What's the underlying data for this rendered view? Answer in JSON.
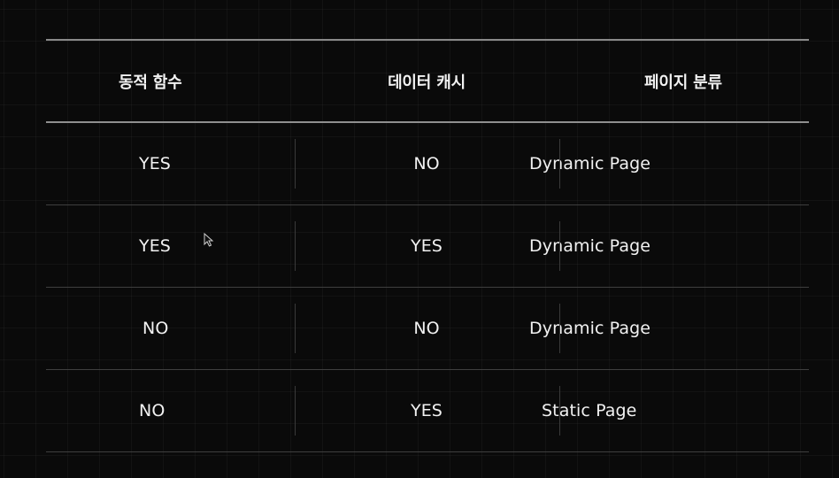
{
  "table": {
    "headers": [
      "동적 함수",
      "데이터 캐시",
      "페이지 분류"
    ],
    "rows": [
      [
        "YES",
        "NO",
        "Dynamic Page"
      ],
      [
        "YES",
        "YES",
        "Dynamic Page"
      ],
      [
        "NO",
        "NO",
        "Dynamic Page"
      ],
      [
        "NO",
        "YES",
        "Static Page"
      ]
    ]
  },
  "cursor": {
    "icon": "arrow-cursor-icon"
  },
  "colors": {
    "background": "#0a0a0a",
    "text": "#f2f2f2",
    "rule": "#8a8a8a"
  }
}
